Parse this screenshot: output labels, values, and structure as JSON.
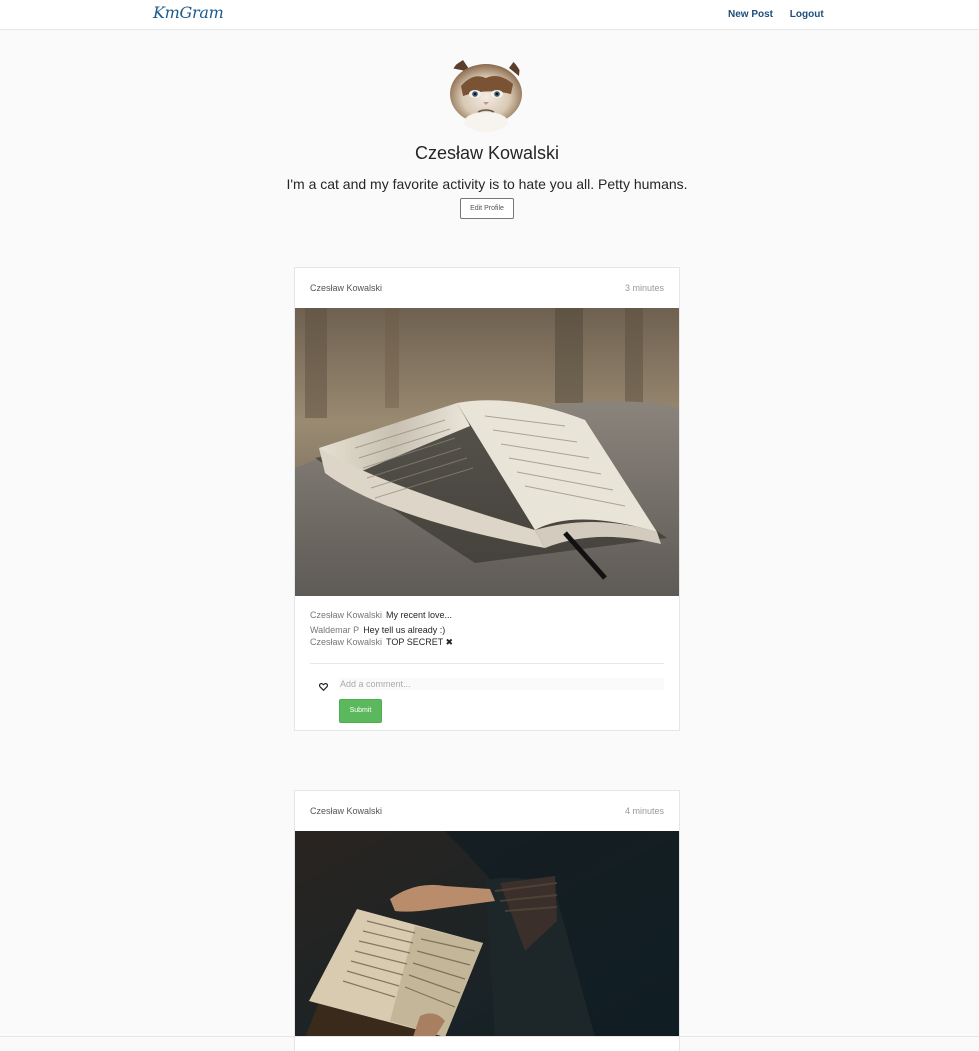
{
  "navbar": {
    "brand": "KmGram",
    "new_post": "New Post",
    "logout": "Logout"
  },
  "profile": {
    "name": "Czesław Kowalski",
    "bio": "I'm a cat and my favorite activity is to hate you all. Petty humans.",
    "edit_label": "Edit Profile"
  },
  "posts": [
    {
      "author": "Czesław Kowalski",
      "time": "3 minutes",
      "comments": [
        {
          "author": "Czesław Kowalski",
          "text": "My recent love..."
        },
        {
          "author": "Waldemar P",
          "text": "Hey tell us already :)"
        },
        {
          "author": "Czesław Kowalski",
          "text": "TOP SECRET ✖"
        }
      ],
      "comment_placeholder": "Add a comment...",
      "submit_label": "Submit"
    },
    {
      "author": "Czesław Kowalski",
      "time": "4 minutes"
    }
  ],
  "colors": {
    "brand": "#1e5b8d",
    "submit": "#5cb85c",
    "background": "#fafafa"
  }
}
